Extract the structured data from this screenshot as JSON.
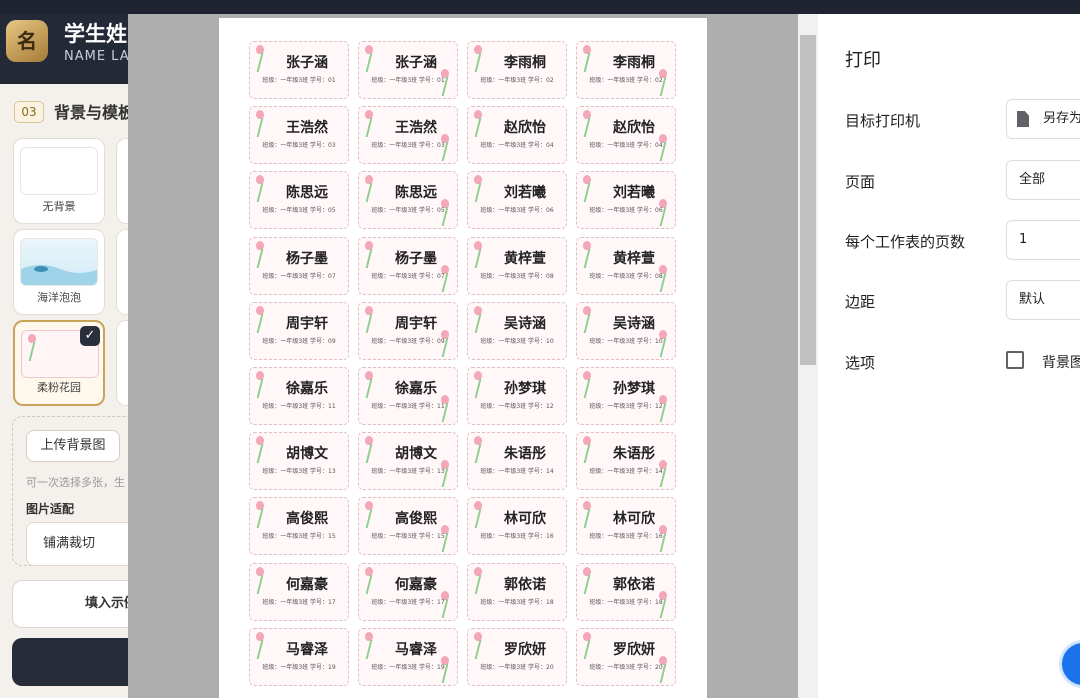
{
  "app": {
    "logo_char": "名",
    "title": "学生姓",
    "subtitle": "NAME LAB",
    "section_number": "03",
    "section_title": "背景与模板",
    "backgrounds": [
      {
        "label": "无背景"
      },
      {
        "label": "海洋泡泡"
      },
      {
        "label": "柔粉花园",
        "selected": true
      }
    ],
    "check_mark": "✓",
    "upload_button": "上传背景图",
    "upload_hint": "可一次选择多张，生",
    "fit_label": "图片适配",
    "fit_value": "铺满裁切",
    "fill_sample_button": "填入示例"
  },
  "print_dialog": {
    "title": "打印",
    "destination_label": "目标打印机",
    "destination_value": "另存为",
    "pages_label": "页面",
    "pages_value": "全部",
    "pages_per_sheet_label": "每个工作表的页数",
    "pages_per_sheet_value": "1",
    "margins_label": "边距",
    "margins_value": "默认",
    "options_label": "选项",
    "options_checkbox_label": "背景图",
    "options_checked": false,
    "accent_color": "#1a73e8"
  },
  "students": [
    {
      "name": "张子涵",
      "info": "班级：一年级3班  学号：01"
    },
    {
      "name": "李雨桐",
      "info": "班级：一年级3班  学号：02"
    },
    {
      "name": "王浩然",
      "info": "班级：一年级3班  学号：03"
    },
    {
      "name": "赵欣怡",
      "info": "班级：一年级3班  学号：04"
    },
    {
      "name": "陈思远",
      "info": "班级：一年级3班  学号：05"
    },
    {
      "name": "刘若曦",
      "info": "班级：一年级3班  学号：06"
    },
    {
      "name": "杨子墨",
      "info": "班级：一年级3班  学号：07"
    },
    {
      "name": "黄梓萱",
      "info": "班级：一年级3班  学号：08"
    },
    {
      "name": "周宇轩",
      "info": "班级：一年级3班  学号：09"
    },
    {
      "name": "吴诗涵",
      "info": "班级：一年级3班  学号：10"
    },
    {
      "name": "徐嘉乐",
      "info": "班级：一年级3班  学号：11"
    },
    {
      "name": "孙梦琪",
      "info": "班级：一年级3班  学号：12"
    },
    {
      "name": "胡博文",
      "info": "班级：一年级3班  学号：13"
    },
    {
      "name": "朱语彤",
      "info": "班级：一年级3班  学号：14"
    },
    {
      "name": "高俊熙",
      "info": "班级：一年级3班  学号：15"
    },
    {
      "name": "林可欣",
      "info": "班级：一年级3班  学号：16"
    },
    {
      "name": "何嘉豪",
      "info": "班级：一年级3班  学号：17"
    },
    {
      "name": "郭依诺",
      "info": "班级：一年级3班  学号：18"
    },
    {
      "name": "马睿泽",
      "info": "班级：一年级3班  学号：19"
    },
    {
      "name": "罗欣妍",
      "info": "班级：一年级3班  学号：20"
    }
  ]
}
